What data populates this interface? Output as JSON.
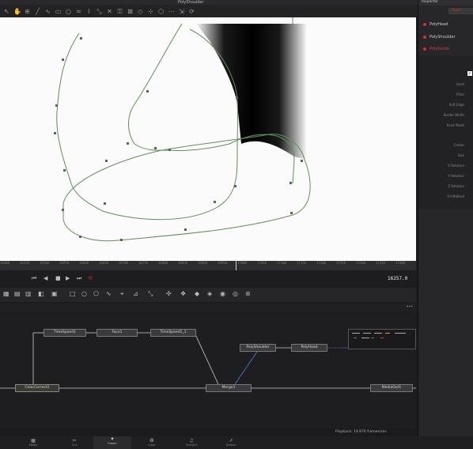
{
  "viewer": {
    "title": "PolyShoulder"
  },
  "ruler": {
    "ticks": [
      "16400",
      "16250",
      "16500",
      "16550",
      "16600",
      "16650",
      "16700",
      "16750",
      "16800",
      "16850",
      "16900",
      "16950",
      "17000",
      "17050",
      "17100",
      "17150",
      "17200",
      "17250",
      "17300",
      "17350",
      "17400"
    ]
  },
  "transport": {
    "timecode": "16257.0"
  },
  "nodes": {
    "timespeed1": "TimeSpeed1",
    "face1": "Face1",
    "timespeed1_1": "TimeSpeed1_1",
    "polyshoulder": "PolyShoulder",
    "polyhead": "PolyHead",
    "colorcorrect1": "ColorCorrect1",
    "merge1": "Merge1",
    "mediaout1": "MediaOut1"
  },
  "status": {
    "playback": "Playback: 19.876 frames/sec"
  },
  "inspector": {
    "title": "Inspector",
    "tools_tab": "Tools",
    "items": [
      {
        "label": "PolyHead",
        "color": "#cc3333"
      },
      {
        "label": "PolyShoulder",
        "color": "#cc3333"
      },
      {
        "label": "PolyGuide",
        "color": "#cc3333"
      }
    ],
    "params": [
      "Level",
      "Filter",
      "Soft Edge",
      "Border Width",
      "Paint Mode",
      "",
      "Center",
      "Size",
      "X Rotation",
      "Y Rotation",
      "Z Rotation",
      "Fill Method"
    ]
  },
  "pages": [
    "Media",
    "Cut",
    "Fusion",
    "Color",
    "Fairlight",
    "Deliver"
  ],
  "colors": {
    "accent": "#d0301e",
    "spline": "#5f8f5a"
  }
}
